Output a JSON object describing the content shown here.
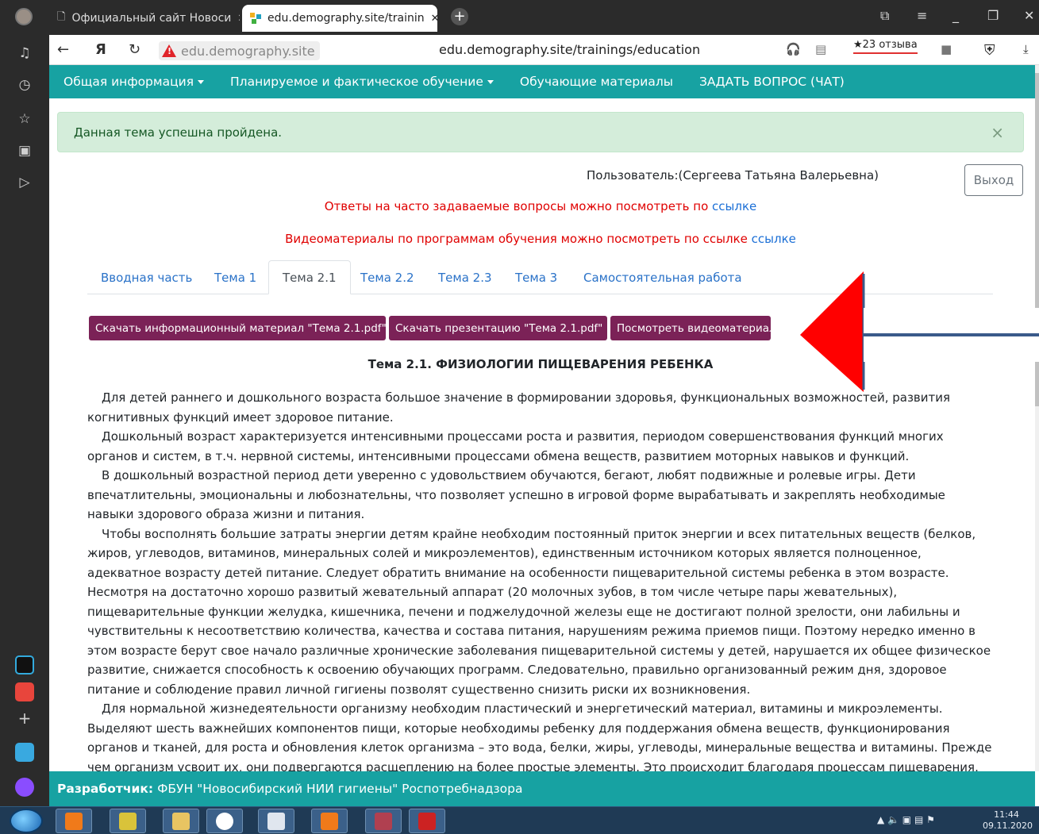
{
  "browser": {
    "tabs": [
      {
        "title": "Официальный сайт Новоси",
        "active": false
      },
      {
        "title": "edu.demography.site/trainin",
        "active": true
      }
    ],
    "site_chip": "edu.demography.site",
    "url": "edu.demography.site/trainings/education",
    "reviews": "★23 отзыва"
  },
  "nav": {
    "items": [
      {
        "label": "Общая информация",
        "dropdown": true
      },
      {
        "label": "Планируемое и фактическое обучение",
        "dropdown": true
      },
      {
        "label": "Обучающие материалы",
        "dropdown": false
      },
      {
        "label": "ЗАДАТЬ ВОПРОС (ЧАТ)",
        "dropdown": false
      }
    ],
    "color": "#17a2a2"
  },
  "alert": {
    "text": "Данная тема успешна пройдена.",
    "close": "×"
  },
  "user": {
    "label": "Пользователь:(Сергеева Татьяна Валерьевна)",
    "logout": "Выход"
  },
  "notices": {
    "faq_text": "Ответы на часто задаваемые вопросы можно посмотреть по ",
    "faq_link": "ссылке",
    "video_text": "Видеоматериалы по программам обучения можно посмотреть по ссылке ",
    "video_link": "ссылке"
  },
  "tabs": [
    {
      "label": "Вводная часть",
      "active": false
    },
    {
      "label": "Тема 1",
      "active": false
    },
    {
      "label": "Тема 2.1",
      "active": true
    },
    {
      "label": "Тема 2.2",
      "active": false
    },
    {
      "label": "Тема 2.3",
      "active": false
    },
    {
      "label": "Тема 3",
      "active": false
    },
    {
      "label": "Самостоятельная работа",
      "active": false
    }
  ],
  "buttons": {
    "download_info": "Скачать информационный материал \"Тема 2.1.pdf\"",
    "download_presentation": "Скачать презентацию \"Тема 2.1.pdf\"",
    "watch_video": "Посмотреть видеоматериал",
    "color": "#7b2257"
  },
  "content": {
    "title": "Тема 2.1. ФИЗИОЛОГИИ ПИЩЕВАРЕНИЯ РЕБЕНКА",
    "paragraphs": [
      "Для детей раннего и дошкольного возраста большое значение в формировании здоровья, функциональных возможностей, развития когнитивных функций имеет здоровое питание.",
      "Дошкольный возраст характеризуется интенсивными процессами роста и развития, периодом совершенствования функций многих органов и систем, в т.ч. нервной системы, интенсивными процессами обмена веществ, развитием моторных навыков и функций.",
      "В дошкольный возрастной период дети уверенно с удовольствием обучаются, бегают, любят подвижные и ролевые игры. Дети впечатлительны, эмоциональны и любознательны, что позволяет успешно в игровой форме вырабатывать и закреплять необходимые навыки здорового образа жизни и питания.",
      "Чтобы восполнять большие затраты энергии детям крайне необходим постоянный приток энергии и всех питательных веществ (белков, жиров, углеводов, витаминов, минеральных солей и микроэлементов), единственным источником которых является полноценное, адекватное возрасту детей питание. Следует обратить внимание на особенности пищеварительной системы ребенка в этом возрасте. Несмотря на достаточно хорошо развитый жевательный аппарат (20 молочных зубов, в том числе четыре пары жевательных), пищеварительные функции желудка, кишечника, печени и поджелудочной железы еще не достигают полной зрелости, они лабильны и чувствительны к несоответствию количества, качества и состава питания, нарушениям режима приемов пищи. Поэтому нередко именно в этом возрасте берут свое начало различные хронические заболевания пищеварительной системы у детей, нарушается их общее физическое развитие, снижается способность к освоению обучающих программ. Следовательно, правильно организованный режим дня, здоровое питание и соблюдение правил личной гигиены позволят существенно снизить риски их возникновения.",
      "Для нормальной жизнедеятельности организму необходим пластический и энергетический материал, витамины и микроэлементы. Выделяют шесть важнейших компонентов пищи, которые необходимы ребенку для поддержания обмена веществ, функционирования органов и тканей, для роста и обновления клеток организма – это вода, белки, жиры, углеводы, минеральные вещества и витамины. Прежде чем организм усвоит их, они подвергаются расщеплению на более простые элементы. Это происходит благодаря процессам пищеварения."
    ]
  },
  "footer": {
    "label": "Разработчик:",
    "text": "ФБУН \"Новосибирский НИИ гигиены\" Роспотребнадзора"
  },
  "taskbar": {
    "time": "11:44",
    "date": "09.11.2020"
  }
}
